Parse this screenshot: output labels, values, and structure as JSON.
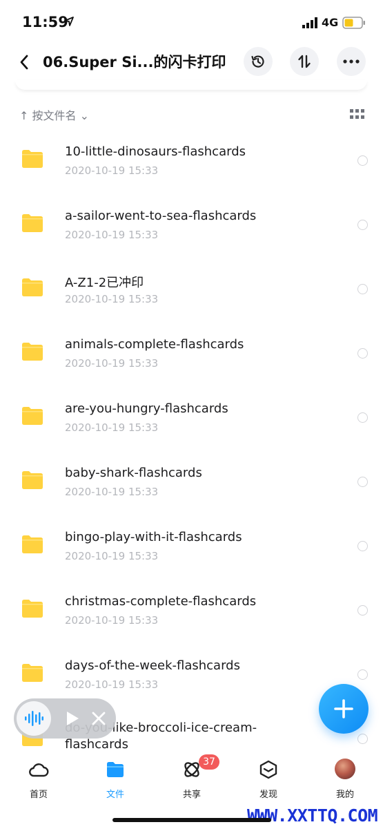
{
  "status_bar": {
    "time": "11:59",
    "network": "4G",
    "icons": [
      "location-arrow-icon",
      "signal-icon",
      "battery-icon"
    ]
  },
  "header": {
    "title": "06.Super Si...的闪卡打印",
    "icons": [
      "back-icon",
      "history-icon",
      "sort-icon",
      "more-icon"
    ]
  },
  "sort_bar": {
    "label": "↑ 按文件名 ⌄",
    "grid_icon": "grid-view-icon"
  },
  "files": [
    {
      "name": "10-little-dinosaurs-flashcards",
      "date": "2020-10-19 15:33"
    },
    {
      "name": "a-sailor-went-to-sea-flashcards",
      "date": "2020-10-19 15:33"
    },
    {
      "name": "A-Z1-2已冲印",
      "date": "2020-10-19 15:33"
    },
    {
      "name": "animals-complete-flashcards",
      "date": "2020-10-19 15:33"
    },
    {
      "name": "are-you-hungry-flashcards",
      "date": "2020-10-19 15:33"
    },
    {
      "name": "baby-shark-flashcards",
      "date": "2020-10-19 15:33"
    },
    {
      "name": "bingo-play-with-it-flashcards",
      "date": "2020-10-19 15:33"
    },
    {
      "name": "christmas-complete-flashcards",
      "date": "2020-10-19 15:33"
    },
    {
      "name": "days-of-the-week-flashcards",
      "date": "2020-10-19 15:33"
    },
    {
      "name": "do-you-like-broccoli-ice-cream-flashcards",
      "date": ""
    }
  ],
  "tabs": [
    {
      "label": "首页",
      "icon": "cloud-icon"
    },
    {
      "label": "文件",
      "icon": "folder-icon"
    },
    {
      "label": "共享",
      "icon": "share-orbit-icon",
      "badge": "37"
    },
    {
      "label": "发现",
      "icon": "discover-cube-icon"
    },
    {
      "label": "我的",
      "icon": "avatar"
    }
  ],
  "colors": {
    "accent": "#1a9bff",
    "folder": "#ffd23f",
    "badge": "#f25a5a",
    "watermark": "#1a33d6"
  },
  "watermark": "WWW.XXTTQ.COM"
}
